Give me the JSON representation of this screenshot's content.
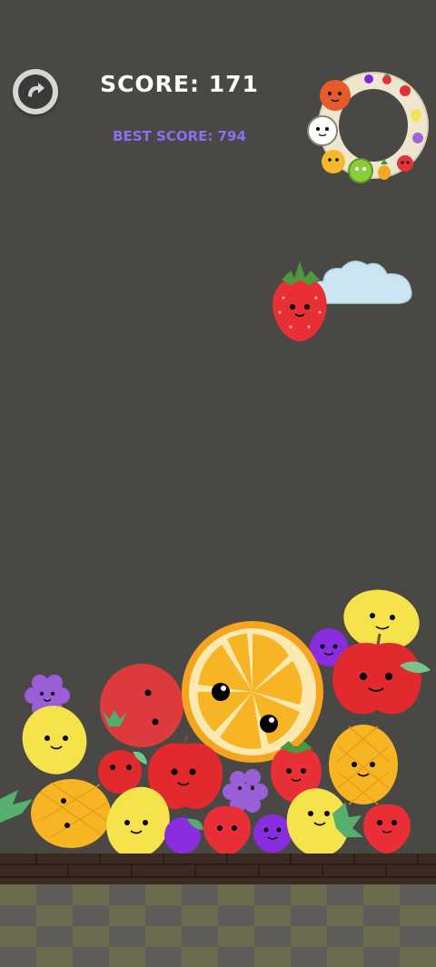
{
  "hud": {
    "score_text": "SCORE: 171",
    "best_score_text": "BEST SCORE: 794",
    "restart_icon": "restart-arrow-icon"
  },
  "game": {
    "next_fruit": "strawberry",
    "evolution_cycle": [
      "cherry",
      "strawberry",
      "grape",
      "lemon",
      "orange",
      "apple",
      "pear",
      "peach",
      "pineapple",
      "melon",
      "watermelon"
    ],
    "board_fruits": [
      "lemon",
      "grape",
      "apple",
      "orange",
      "grape",
      "apple",
      "grape",
      "lemon",
      "cherry",
      "strawberry",
      "apple",
      "pineapple",
      "strawberry",
      "grape",
      "pineapple",
      "lemon",
      "grape",
      "strawberry",
      "grape",
      "lemon",
      "strawberry"
    ]
  },
  "colors": {
    "background": "#4a4844",
    "score_text": "#ffffff",
    "best_score_text": "#8c6ef2",
    "floor_bricks": "#3a2a22",
    "floor_tiles_dark": "#5e5c58",
    "floor_tiles_light": "#6d6b4f"
  }
}
